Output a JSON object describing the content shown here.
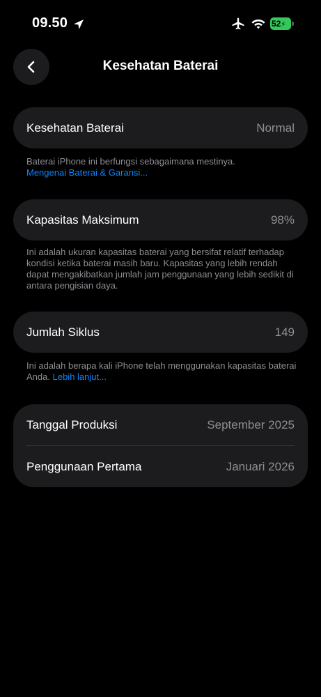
{
  "status_bar": {
    "time": "09.50",
    "battery_level": "52",
    "colors": {
      "battery": "#34c759"
    }
  },
  "nav": {
    "title": "Kesehatan Baterai",
    "back_icon": "chevron-left-icon"
  },
  "sections": {
    "health": {
      "label": "Kesehatan Baterai",
      "value": "Normal",
      "footnote": "Baterai iPhone ini berfungsi sebagaimana mestinya.",
      "link": "Mengenai Baterai & Garansi..."
    },
    "capacity": {
      "label": "Kapasitas Maksimum",
      "value": "98%",
      "footnote": "Ini adalah ukuran kapasitas baterai yang bersifat relatif terhadap kondisi ketika baterai masih baru. Kapasitas yang lebih rendah dapat mengakibatkan jumlah jam penggunaan yang lebih sedikit di antara pengisian daya."
    },
    "cycles": {
      "label": "Jumlah Siklus",
      "value": "149",
      "footnote": "Ini adalah berapa kali iPhone telah menggunakan kapasitas baterai Anda.",
      "link": "Lebih lanjut..."
    },
    "dates": {
      "manufacture_label": "Tanggal Produksi",
      "manufacture_value": "September 2025",
      "first_use_label": "Penggunaan Pertama",
      "first_use_value": "Januari 2026"
    }
  },
  "colors": {
    "background": "#000000",
    "card": "#1c1c1e",
    "secondary_text": "#8e8e93",
    "link": "#0a84ff"
  }
}
